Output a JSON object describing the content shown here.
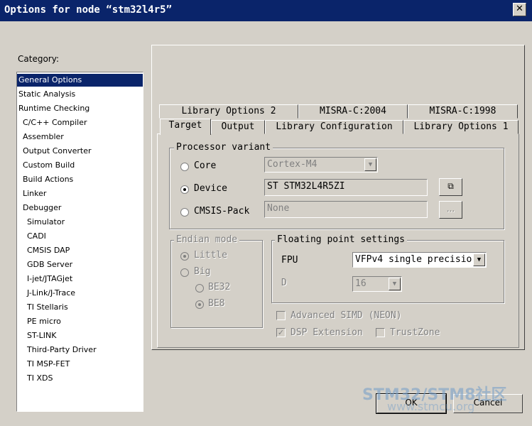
{
  "window": {
    "title": "Options for node “stm32l4r5”",
    "close_glyph": "✕"
  },
  "category": {
    "label": "Category:",
    "items": [
      "General Options",
      "Static Analysis",
      "Runtime Checking",
      "C/C++ Compiler",
      "Assembler",
      "Output Converter",
      "Custom Build",
      "Build Actions",
      "Linker",
      "Debugger",
      "Simulator",
      "CADI",
      "CMSIS DAP",
      "GDB Server",
      "I-jet/JTAGjet",
      "J-Link/J-Trace",
      "TI Stellaris",
      "PE micro",
      "ST-LINK",
      "Third-Party Driver",
      "TI MSP-FET",
      "TI XDS"
    ],
    "selected": "General Options"
  },
  "tabs": {
    "row1": [
      "Library Options 2",
      "MISRA-C:2004",
      "MISRA-C:1998"
    ],
    "row2": [
      "Target",
      "Output",
      "Library Configuration",
      "Library Options 1"
    ],
    "active": "Target"
  },
  "processor_variant": {
    "legend": "Processor variant",
    "core_label": "Core",
    "core_value": "Cortex-M4",
    "device_label": "Device",
    "device_value": "ST STM32L4R5ZI",
    "cmsis_label": "CMSIS-Pack",
    "cmsis_value": "None",
    "cmsis_button": "...",
    "selected": "Device"
  },
  "endian_mode": {
    "legend": "Endian mode",
    "little": "Little",
    "big": "Big",
    "be32": "BE32",
    "be8": "BE8"
  },
  "floating_point": {
    "legend": "Floating point settings",
    "fpu_label": "FPU",
    "fpu_value": "VFPv4 single precisio",
    "d_label": "D",
    "d_value": "16"
  },
  "options": {
    "advanced_simd": "Advanced SIMD (NEON)",
    "dsp_extension": "DSP Extension",
    "trustzone": "TrustZone"
  },
  "buttons": {
    "ok": "OK",
    "cancel": "Cancel"
  },
  "watermark": {
    "line1": "STM32/STM8社区",
    "line2": "www.stmcu.org"
  }
}
